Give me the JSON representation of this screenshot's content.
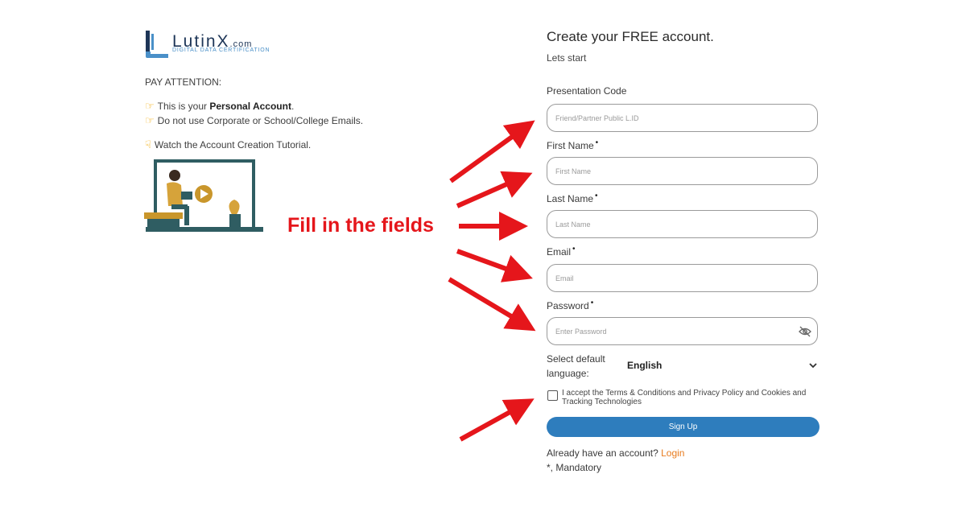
{
  "brand": {
    "name": "LutinX",
    "domain": ".com",
    "tagline": "DIGITAL DATA CERTIFICATION",
    "colors": {
      "primary": "#1d3557",
      "accent": "#4a90c8"
    }
  },
  "left": {
    "pay_attention": "PAY ATTENTION:",
    "line1_prefix": "This is your",
    "line1_bold": "Personal Account",
    "line1_suffix": ".",
    "line2": "Do not use Corporate or School/College Emails.",
    "line3": "Watch the Account Creation Tutorial.",
    "icons": [
      "pointing-hand-icon",
      "pointing-hand-icon",
      "pointing-down-hand-icon"
    ]
  },
  "overlay": {
    "text": "Fill in the fields",
    "color": "#e5161b"
  },
  "form": {
    "title": "Create your FREE account.",
    "subtitle": "Lets start",
    "required_marker": "•",
    "presentation_code": {
      "label": "Presentation Code",
      "placeholder": "Friend/Partner Public L.ID",
      "value": ""
    },
    "first_name": {
      "label": "First Name",
      "placeholder": "First Name",
      "value": ""
    },
    "last_name": {
      "label": "Last Name",
      "placeholder": "Last Name",
      "value": ""
    },
    "email": {
      "label": "Email",
      "placeholder": "Email",
      "value": ""
    },
    "password": {
      "label": "Password",
      "placeholder": "Enter Password",
      "value": "",
      "toggle_icon": "eye-slash-icon"
    },
    "language": {
      "label": "Select default language:",
      "value": "English"
    },
    "terms": "I accept the Terms & Conditions and Privacy Policy and Cookies and Tracking Technologies",
    "terms_checked": false,
    "signup_label": "Sign Up",
    "signup_color": "#2e7dbd",
    "already_text": "Already have an account?",
    "login_label": "Login",
    "mandatory_note": "*, Mandatory"
  }
}
